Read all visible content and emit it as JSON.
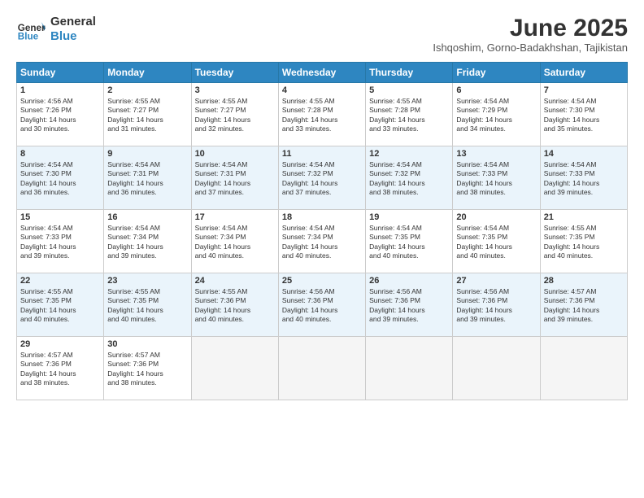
{
  "header": {
    "logo_line1": "General",
    "logo_line2": "Blue",
    "month": "June 2025",
    "location": "Ishqoshim, Gorno-Badakhshan, Tajikistan"
  },
  "weekdays": [
    "Sunday",
    "Monday",
    "Tuesday",
    "Wednesday",
    "Thursday",
    "Friday",
    "Saturday"
  ],
  "weeks": [
    [
      {
        "day": 1,
        "lines": [
          "Sunrise: 4:56 AM",
          "Sunset: 7:26 PM",
          "Daylight: 14 hours",
          "and 30 minutes."
        ]
      },
      {
        "day": 2,
        "lines": [
          "Sunrise: 4:55 AM",
          "Sunset: 7:27 PM",
          "Daylight: 14 hours",
          "and 31 minutes."
        ]
      },
      {
        "day": 3,
        "lines": [
          "Sunrise: 4:55 AM",
          "Sunset: 7:27 PM",
          "Daylight: 14 hours",
          "and 32 minutes."
        ]
      },
      {
        "day": 4,
        "lines": [
          "Sunrise: 4:55 AM",
          "Sunset: 7:28 PM",
          "Daylight: 14 hours",
          "and 33 minutes."
        ]
      },
      {
        "day": 5,
        "lines": [
          "Sunrise: 4:55 AM",
          "Sunset: 7:28 PM",
          "Daylight: 14 hours",
          "and 33 minutes."
        ]
      },
      {
        "day": 6,
        "lines": [
          "Sunrise: 4:54 AM",
          "Sunset: 7:29 PM",
          "Daylight: 14 hours",
          "and 34 minutes."
        ]
      },
      {
        "day": 7,
        "lines": [
          "Sunrise: 4:54 AM",
          "Sunset: 7:30 PM",
          "Daylight: 14 hours",
          "and 35 minutes."
        ]
      }
    ],
    [
      {
        "day": 8,
        "lines": [
          "Sunrise: 4:54 AM",
          "Sunset: 7:30 PM",
          "Daylight: 14 hours",
          "and 36 minutes."
        ]
      },
      {
        "day": 9,
        "lines": [
          "Sunrise: 4:54 AM",
          "Sunset: 7:31 PM",
          "Daylight: 14 hours",
          "and 36 minutes."
        ]
      },
      {
        "day": 10,
        "lines": [
          "Sunrise: 4:54 AM",
          "Sunset: 7:31 PM",
          "Daylight: 14 hours",
          "and 37 minutes."
        ]
      },
      {
        "day": 11,
        "lines": [
          "Sunrise: 4:54 AM",
          "Sunset: 7:32 PM",
          "Daylight: 14 hours",
          "and 37 minutes."
        ]
      },
      {
        "day": 12,
        "lines": [
          "Sunrise: 4:54 AM",
          "Sunset: 7:32 PM",
          "Daylight: 14 hours",
          "and 38 minutes."
        ]
      },
      {
        "day": 13,
        "lines": [
          "Sunrise: 4:54 AM",
          "Sunset: 7:33 PM",
          "Daylight: 14 hours",
          "and 38 minutes."
        ]
      },
      {
        "day": 14,
        "lines": [
          "Sunrise: 4:54 AM",
          "Sunset: 7:33 PM",
          "Daylight: 14 hours",
          "and 39 minutes."
        ]
      }
    ],
    [
      {
        "day": 15,
        "lines": [
          "Sunrise: 4:54 AM",
          "Sunset: 7:33 PM",
          "Daylight: 14 hours",
          "and 39 minutes."
        ]
      },
      {
        "day": 16,
        "lines": [
          "Sunrise: 4:54 AM",
          "Sunset: 7:34 PM",
          "Daylight: 14 hours",
          "and 39 minutes."
        ]
      },
      {
        "day": 17,
        "lines": [
          "Sunrise: 4:54 AM",
          "Sunset: 7:34 PM",
          "Daylight: 14 hours",
          "and 40 minutes."
        ]
      },
      {
        "day": 18,
        "lines": [
          "Sunrise: 4:54 AM",
          "Sunset: 7:34 PM",
          "Daylight: 14 hours",
          "and 40 minutes."
        ]
      },
      {
        "day": 19,
        "lines": [
          "Sunrise: 4:54 AM",
          "Sunset: 7:35 PM",
          "Daylight: 14 hours",
          "and 40 minutes."
        ]
      },
      {
        "day": 20,
        "lines": [
          "Sunrise: 4:54 AM",
          "Sunset: 7:35 PM",
          "Daylight: 14 hours",
          "and 40 minutes."
        ]
      },
      {
        "day": 21,
        "lines": [
          "Sunrise: 4:55 AM",
          "Sunset: 7:35 PM",
          "Daylight: 14 hours",
          "and 40 minutes."
        ]
      }
    ],
    [
      {
        "day": 22,
        "lines": [
          "Sunrise: 4:55 AM",
          "Sunset: 7:35 PM",
          "Daylight: 14 hours",
          "and 40 minutes."
        ]
      },
      {
        "day": 23,
        "lines": [
          "Sunrise: 4:55 AM",
          "Sunset: 7:35 PM",
          "Daylight: 14 hours",
          "and 40 minutes."
        ]
      },
      {
        "day": 24,
        "lines": [
          "Sunrise: 4:55 AM",
          "Sunset: 7:36 PM",
          "Daylight: 14 hours",
          "and 40 minutes."
        ]
      },
      {
        "day": 25,
        "lines": [
          "Sunrise: 4:56 AM",
          "Sunset: 7:36 PM",
          "Daylight: 14 hours",
          "and 40 minutes."
        ]
      },
      {
        "day": 26,
        "lines": [
          "Sunrise: 4:56 AM",
          "Sunset: 7:36 PM",
          "Daylight: 14 hours",
          "and 39 minutes."
        ]
      },
      {
        "day": 27,
        "lines": [
          "Sunrise: 4:56 AM",
          "Sunset: 7:36 PM",
          "Daylight: 14 hours",
          "and 39 minutes."
        ]
      },
      {
        "day": 28,
        "lines": [
          "Sunrise: 4:57 AM",
          "Sunset: 7:36 PM",
          "Daylight: 14 hours",
          "and 39 minutes."
        ]
      }
    ],
    [
      {
        "day": 29,
        "lines": [
          "Sunrise: 4:57 AM",
          "Sunset: 7:36 PM",
          "Daylight: 14 hours",
          "and 38 minutes."
        ]
      },
      {
        "day": 30,
        "lines": [
          "Sunrise: 4:57 AM",
          "Sunset: 7:36 PM",
          "Daylight: 14 hours",
          "and 38 minutes."
        ]
      },
      null,
      null,
      null,
      null,
      null
    ]
  ]
}
